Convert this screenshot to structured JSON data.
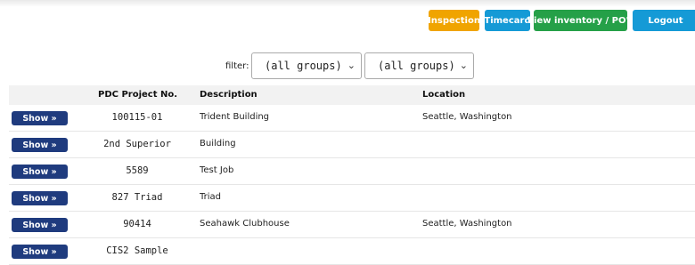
{
  "header": {
    "buttons": {
      "inspection": "Inspection",
      "timecard": "Timecard",
      "inventory": "View inventory / PO's",
      "logout": "Logout"
    }
  },
  "filter": {
    "label": "filter:",
    "group1": "(all groups)",
    "group2": "(all groups)"
  },
  "table": {
    "columns": [
      "",
      "PDC Project No.",
      "Description",
      "Location"
    ],
    "show_label": "Show »",
    "rows": [
      {
        "project": "100115-01",
        "description": "Trident Building",
        "location": "Seattle, Washington"
      },
      {
        "project": "2nd Superior",
        "description": "Building",
        "location": ""
      },
      {
        "project": "5589",
        "description": "Test Job",
        "location": ""
      },
      {
        "project": "827 Triad",
        "description": "Triad",
        "location": ""
      },
      {
        "project": "90414",
        "description": "Seahawk Clubhouse",
        "location": "Seattle, Washington"
      },
      {
        "project": "CIS2 Sample",
        "description": "",
        "location": ""
      }
    ]
  },
  "colors": {
    "inspection": "#f0a400",
    "timecard": "#159ad6",
    "inventory": "#25a048",
    "logout": "#159ad6",
    "show_button": "#1f3b7e"
  }
}
